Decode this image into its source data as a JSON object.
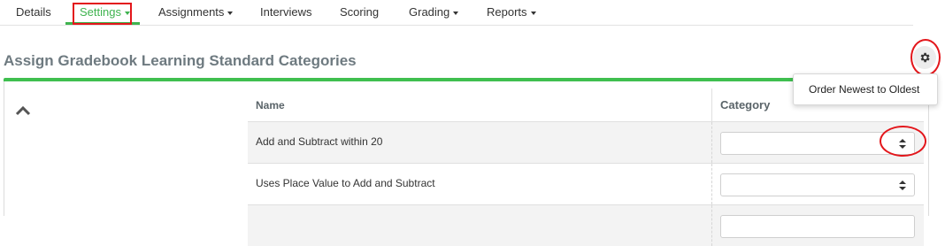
{
  "nav": {
    "items": [
      {
        "label": "Details",
        "has_caret": false
      },
      {
        "label": "Settings",
        "has_caret": true,
        "active": true
      },
      {
        "label": "Assignments",
        "has_caret": true
      },
      {
        "label": "Interviews",
        "has_caret": false
      },
      {
        "label": "Scoring",
        "has_caret": false
      },
      {
        "label": "Grading",
        "has_caret": true
      },
      {
        "label": "Reports",
        "has_caret": true
      }
    ]
  },
  "page": {
    "title": "Assign Gradebook Learning Standard Categories"
  },
  "settings_menu": {
    "icon": "gear-icon",
    "items": [
      {
        "label": "Order Newest to Oldest"
      }
    ]
  },
  "table": {
    "headers": {
      "name": "Name",
      "category": "Category"
    },
    "rows": [
      {
        "name": "Add and Subtract within 20",
        "category": ""
      },
      {
        "name": "Uses Place Value to Add and Subtract",
        "category": ""
      },
      {
        "name": "",
        "category": ""
      }
    ]
  },
  "colors": {
    "accent_green": "#3fb34f",
    "annotation_red": "#e3161b",
    "title_gray": "#6e7a80"
  }
}
